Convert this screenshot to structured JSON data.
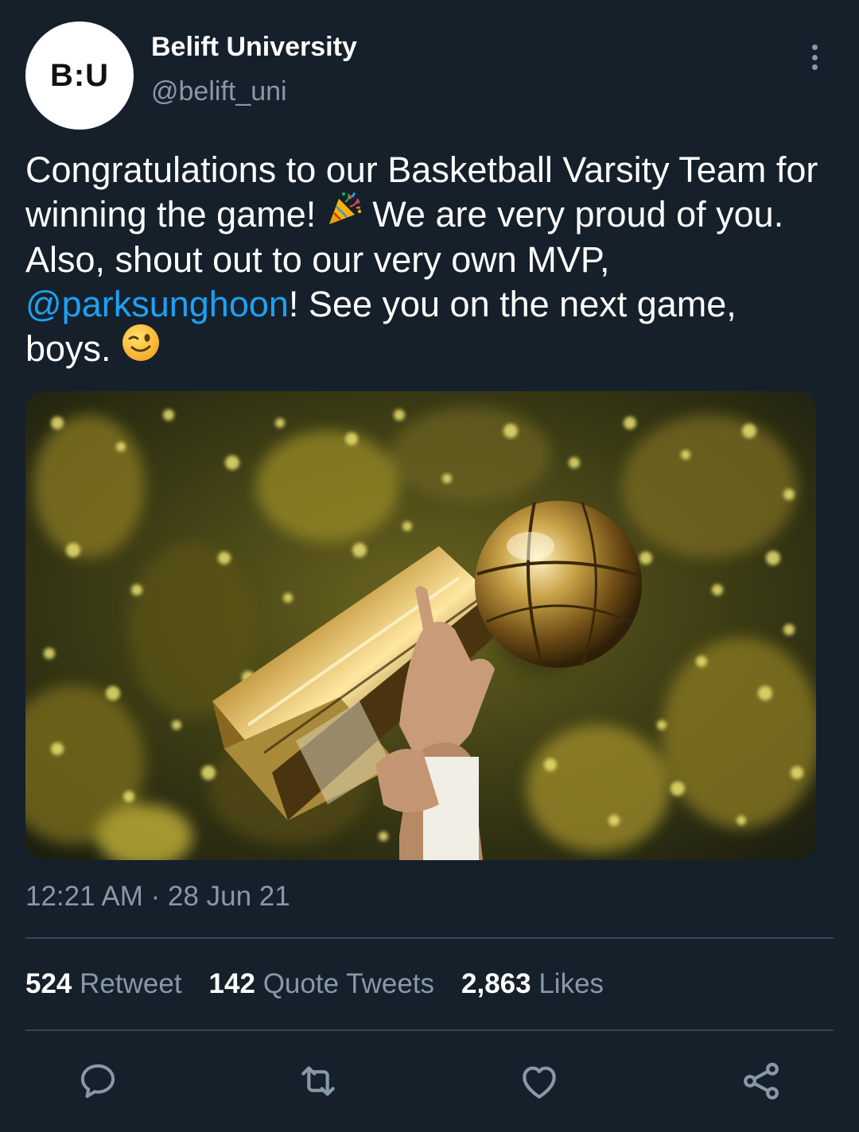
{
  "tweet": {
    "author": {
      "avatar_text": "B:U",
      "display_name": "Belift University",
      "handle": "@belift_uni"
    },
    "text": {
      "part1": "Congratulations to our Basketball Varsity Team for winning the game!",
      "emoji1": "party-popper-icon",
      "part2": "We are very proud of you. Also, shout out to our very own MVP,",
      "mention": "@parksunghoon",
      "part3": "! See you on the next game, boys.",
      "emoji2": "winking-face-icon"
    },
    "media": {
      "description_icon": "trophy-photo"
    },
    "timestamp": "12:21 AM · 28 Jun 21",
    "stats": [
      {
        "count": "524",
        "label": "Retweet"
      },
      {
        "count": "142",
        "label": "Quote Tweets"
      },
      {
        "count": "2,863",
        "label": "Likes"
      }
    ],
    "actions": [
      "reply-icon",
      "retweet-icon",
      "like-icon",
      "share-icon"
    ]
  },
  "colors": {
    "background": "#15202b",
    "accent": "#1da1f2",
    "secondary_text": "#8899a6",
    "divider": "#38444d"
  }
}
